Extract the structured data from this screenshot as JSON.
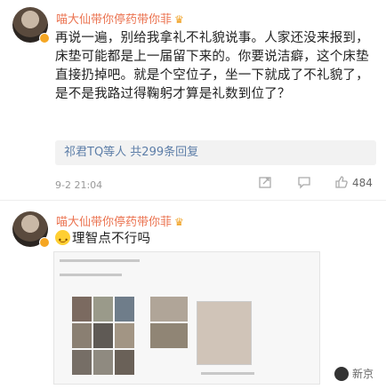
{
  "comments": [
    {
      "username": "喵大仙带你停药带你菲",
      "text": "再说一遍，别给我拿礼不礼貌说事。人家还没来报到，床垫可能都是上一届留下来的。你要说洁癖，这个床垫直接扔掉吧。就是个空位子，坐一下就成了不礼貌了，是不是我路过得鞠躬才算是礼数到位了？",
      "replies_summary": "祁君TQ等人  共299条回复",
      "time": "9-2 21:04",
      "likes": "484"
    },
    {
      "username": "喵大仙带你停药带你菲",
      "text": "理智点不行吗",
      "emoji": "grinning-sweat-emoji"
    }
  ],
  "watermark": {
    "text": "新京"
  },
  "icons": {
    "crown": "crown-icon",
    "vip": "vip-badge-icon",
    "share": "share-icon",
    "comment": "comment-icon",
    "like": "thumbs-up-icon"
  },
  "colors": {
    "username": "#eb7350",
    "reply_link": "#5d7ea8",
    "badge": "#f5a623"
  }
}
